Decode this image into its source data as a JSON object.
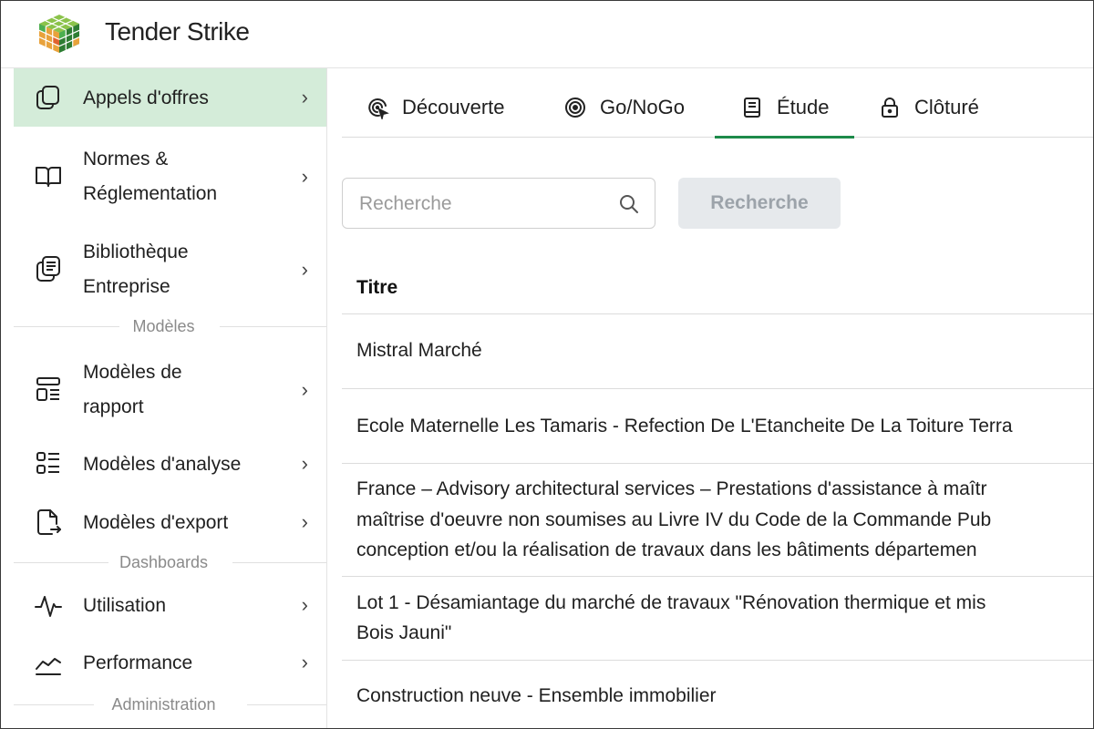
{
  "app": {
    "title": "Tender Strike",
    "logo_colors": [
      "#e8a23b",
      "#e0612f",
      "#4caf50",
      "#8bc34a",
      "#2e7d32"
    ]
  },
  "sidebar": {
    "items": [
      {
        "label": "Appels d'offres",
        "icon": "documents-icon",
        "active": true
      },
      {
        "label_lines": [
          "Normes &",
          "Réglementation"
        ],
        "icon": "book-icon"
      },
      {
        "label_lines": [
          "Bibliothèque",
          "Entreprise"
        ],
        "icon": "library-icon"
      },
      {
        "label_lines": [
          "Modèles de",
          "rapport"
        ],
        "icon": "report-template-icon"
      },
      {
        "label": "Modèles d'analyse",
        "icon": "analysis-template-icon"
      },
      {
        "label": "Modèles d'export",
        "icon": "export-icon"
      },
      {
        "label": "Utilisation",
        "icon": "activity-icon"
      },
      {
        "label": "Performance",
        "icon": "chart-line-icon"
      }
    ],
    "sections": {
      "models": "Modèles",
      "dashboards": "Dashboards",
      "administration": "Administration"
    },
    "chevron": "›"
  },
  "tabs": [
    {
      "label": "Découverte",
      "icon": "discover-icon"
    },
    {
      "label": "Go/NoGo",
      "icon": "target-icon"
    },
    {
      "label": "Étude",
      "icon": "notebook-icon",
      "active": true
    },
    {
      "label": "Clôturé",
      "icon": "lock-icon"
    }
  ],
  "search": {
    "placeholder": "Recherche",
    "value": "",
    "button_label": "Recherche"
  },
  "table": {
    "header": "Titre",
    "rows": [
      [
        "Mistral Marché"
      ],
      [
        "Ecole Maternelle Les Tamaris - Refection De L'Etancheite De La Toiture Terra"
      ],
      [
        "France – Advisory architectural services – Prestations d'assistance à maîtr",
        "maîtrise d'oeuvre non soumises au Livre IV du Code de la Commande Pub",
        "conception et/ou la réalisation de travaux dans les bâtiments départemen"
      ],
      [
        "Lot 1 - Désamiantage du marché de travaux \"Rénovation thermique et mis",
        "Bois Jauni\""
      ],
      [
        "Construction neuve - Ensemble immobilier"
      ]
    ]
  },
  "colors": {
    "active_bg": "#d4ecd9",
    "accent": "#1d8a4a"
  }
}
